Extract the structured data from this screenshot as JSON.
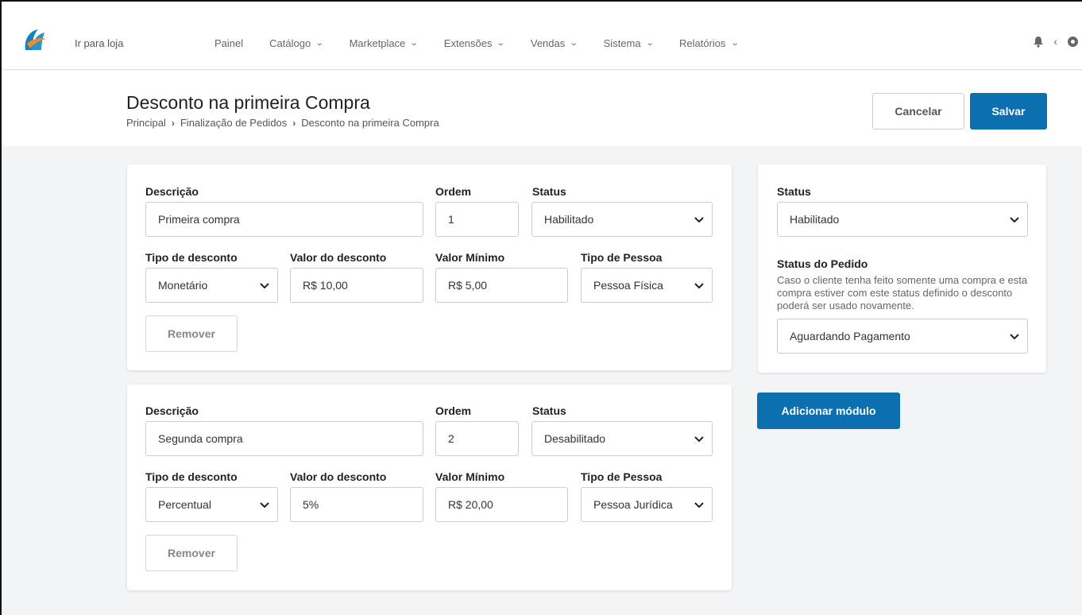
{
  "nav": {
    "store_link": "Ir para loja",
    "items": [
      {
        "label": "Painel",
        "dropdown": false
      },
      {
        "label": "Catálogo",
        "dropdown": true
      },
      {
        "label": "Marketplace",
        "dropdown": true
      },
      {
        "label": "Extensões",
        "dropdown": true
      },
      {
        "label": "Vendas",
        "dropdown": true
      },
      {
        "label": "Sistema",
        "dropdown": true
      },
      {
        "label": "Relatórios",
        "dropdown": true
      }
    ],
    "icons": [
      "bell-icon",
      "chevron-left-icon",
      "gear-icon"
    ]
  },
  "header": {
    "title": "Desconto na primeira Compra",
    "breadcrumb": [
      "Principal",
      "Finalização de Pedidos",
      "Desconto na primeira Compra"
    ],
    "cancel_label": "Cancelar",
    "save_label": "Salvar"
  },
  "labels": {
    "descricao": "Descrição",
    "ordem": "Ordem",
    "status": "Status",
    "tipo_desconto": "Tipo de desconto",
    "valor_desconto": "Valor do desconto",
    "valor_minimo": "Valor Mínimo",
    "tipo_pessoa": "Tipo de Pessoa",
    "remover": "Remover"
  },
  "rules": [
    {
      "descricao": "Primeira compra",
      "ordem": "1",
      "status": "Habilitado",
      "tipo_desconto": "Monetário",
      "valor_desconto": "R$ 10,00",
      "valor_minimo": "R$ 5,00",
      "tipo_pessoa": "Pessoa Física"
    },
    {
      "descricao": "Segunda compra",
      "ordem": "2",
      "status": "Desabilitado",
      "tipo_desconto": "Percentual",
      "valor_desconto": "5%",
      "valor_minimo": "R$ 20,00",
      "tipo_pessoa": "Pessoa Jurídica"
    }
  ],
  "sidebar": {
    "status_label": "Status",
    "status_value": "Habilitado",
    "order_status_label": "Status do Pedido",
    "order_status_help": "Caso o cliente tenha feito somente uma compra e esta compra estiver com este status definido o desconto poderá ser usado novamente.",
    "order_status_value": "Aguardando Pagamento",
    "add_module_label": "Adicionar módulo"
  },
  "colors": {
    "primary": "#0b6fb0",
    "background": "#f3f4f6"
  }
}
